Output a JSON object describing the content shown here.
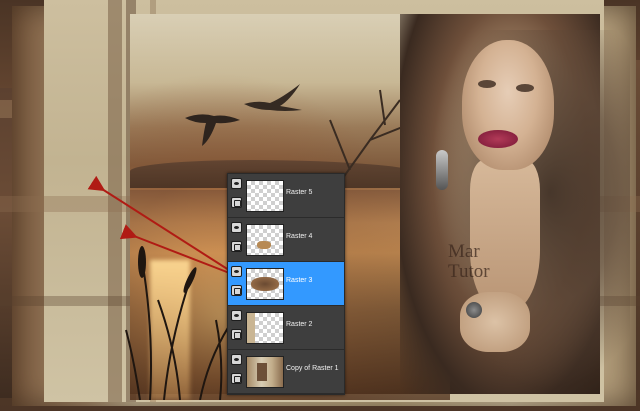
{
  "watermark": {
    "line1": "Mar",
    "line2": "Tutor"
  },
  "layers_panel": {
    "selected_index": 2,
    "selection_color": "#3399ff",
    "layers": [
      {
        "name": "Raster 5",
        "icon_visibility": "eye-icon",
        "icon_lock": "link-icon"
      },
      {
        "name": "Raster 4",
        "icon_visibility": "eye-icon",
        "icon_lock": "link-icon"
      },
      {
        "name": "Raster 3",
        "icon_visibility": "eye-icon",
        "icon_lock": "link-icon"
      },
      {
        "name": "Raster 2",
        "icon_visibility": "eye-icon",
        "icon_lock": "link-icon"
      },
      {
        "name": "Copy of Raster 1",
        "icon_visibility": "eye-icon",
        "icon_lock": "link-icon"
      }
    ]
  },
  "annotation": {
    "arrow_color": "#b01b14",
    "arrow_count": 2
  }
}
